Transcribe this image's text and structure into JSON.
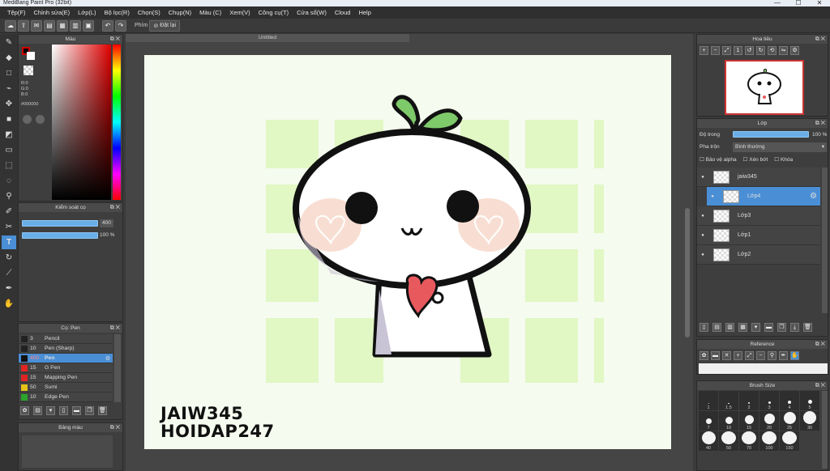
{
  "window": {
    "title": "MediBang Paint Pro (32bit)",
    "controls": [
      "—",
      "☐",
      "✕"
    ]
  },
  "menu": [
    "Tệp(F)",
    "Chỉnh sửa(E)",
    "Lớp(L)",
    "Bộ lọc(R)",
    "Chọn(S)",
    "Chụp(N)",
    "Màu (C)",
    "Xem(V)",
    "Công cụ(T)",
    "Cửa sổ(W)",
    "Cloud",
    "Help"
  ],
  "toolbar": {
    "shortcut_label": "Phím",
    "reset_label": "Đặt lại"
  },
  "color_panel": {
    "title": "Màu",
    "r": "R:0",
    "g": "G:0",
    "b": "B:0",
    "hex": "#000000",
    "fg": "#000000",
    "bg": "#ffffff"
  },
  "brush_control": {
    "title": "Kiểm soát cọ",
    "size_value": "400",
    "opacity_value": "100 %",
    "opacity_fraction": 1.0,
    "size_fraction": 0.85
  },
  "brush_panel": {
    "title": "Cọ: Pen",
    "items": [
      {
        "size": "3",
        "name": "Pencil",
        "color": "#222222"
      },
      {
        "size": "10",
        "name": "Pen (Sharp)",
        "color": "#222222"
      },
      {
        "size": "400",
        "name": "Pen",
        "color": "#111111",
        "selected": true
      },
      {
        "size": "15",
        "name": "G Pen",
        "color": "#e02424"
      },
      {
        "size": "15",
        "name": "Mapping Pen",
        "color": "#e02424"
      },
      {
        "size": "50",
        "name": "Sumi",
        "color": "#e6c31a"
      },
      {
        "size": "10",
        "name": "Edge Pen",
        "color": "#2aa52a"
      }
    ]
  },
  "palette_panel": {
    "title": "Bảng màu"
  },
  "canvas": {
    "tab_title": "Untitled",
    "watermark_line1": "JAIW345",
    "watermark_line2": "HOIDAP247"
  },
  "navigator": {
    "title": "Hoa tiêu"
  },
  "layer_panel": {
    "title": "Lớp",
    "opacity_label": "Độ trong",
    "opacity_value": "100 %",
    "opacity_fraction": 1.0,
    "blend_label": "Pha trộn",
    "blend_value": "Bình thường",
    "protect_alpha": "Bảo vệ alpha",
    "clipping": "Xén bớt",
    "lock": "Khóa",
    "layers": [
      {
        "name": "jaiw345"
      },
      {
        "name": "Lớp4",
        "selected": true
      },
      {
        "name": "Lớp3"
      },
      {
        "name": "Lớp1"
      },
      {
        "name": "Lớp2"
      }
    ]
  },
  "reference_panel": {
    "title": "Reference"
  },
  "brush_size_panel": {
    "title": "Brush Size",
    "sizes": [
      "1",
      "1.5",
      "2",
      "3",
      "4",
      "5",
      "7",
      "10",
      "15",
      "20",
      "25",
      "30",
      "40",
      "50",
      "70",
      "100",
      "150"
    ]
  }
}
